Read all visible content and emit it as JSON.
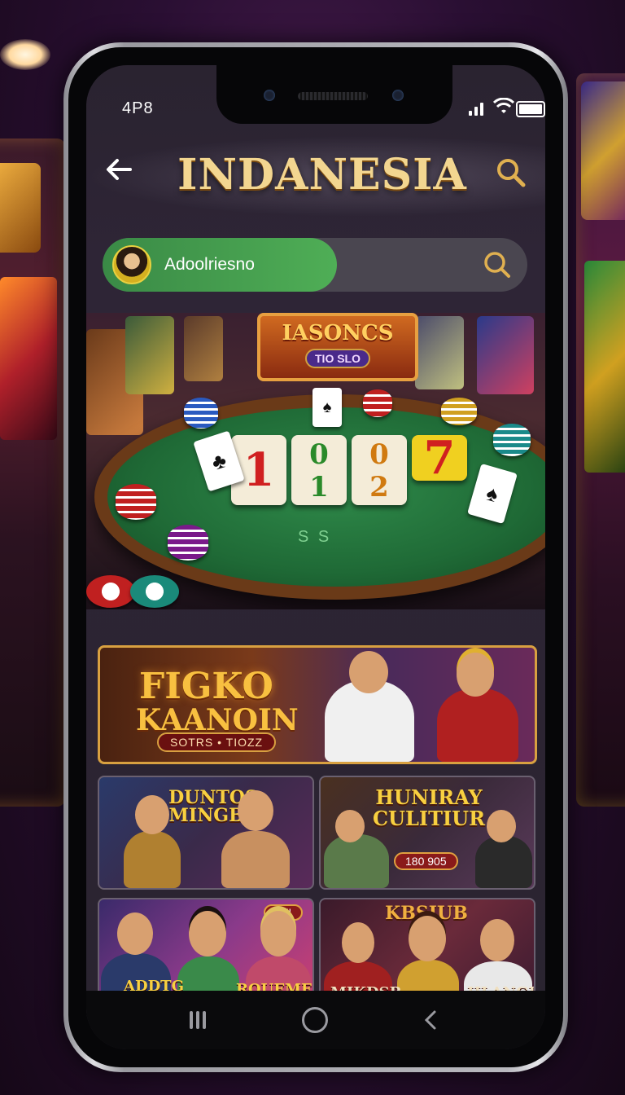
{
  "status_bar": {
    "time": "4P8"
  },
  "header": {
    "title": "INDANESIA"
  },
  "search": {
    "username": "Adoolriesno"
  },
  "hero": {
    "sign_title": "IASONCS",
    "sign_sub": "TIO SLO",
    "tiles": [
      "1",
      "0\n1",
      "0\n2",
      "7"
    ],
    "felt_text": "S S"
  },
  "promos": {
    "main": {
      "title_1": "FIGKO",
      "title_2": "KAANOIN",
      "pill": "SOTRS • TIOZZ"
    },
    "tile_1": {
      "title": "DUNTOS\nMINGBE"
    },
    "tile_2": {
      "title": "HUNIRAY\nCULITIUR",
      "pill": "180 905"
    },
    "tile_3": {
      "badge": "TIJI",
      "left": "ADDTG",
      "right": "RQUEME"
    },
    "tile_4": {
      "title": "KBSIUB",
      "left": "MIKDSR",
      "right": "HLANGR"
    }
  },
  "icons": {
    "back": "arrow-left-icon",
    "search": "search-icon",
    "nav_recent": "recent-apps-icon",
    "nav_home": "home-icon",
    "nav_back": "back-chevron-icon"
  },
  "colors": {
    "title_gold": "#f3d690",
    "user_pill_green": "#4fae56",
    "search_bg": "#4a4650",
    "promo_border": "#d8a040"
  }
}
